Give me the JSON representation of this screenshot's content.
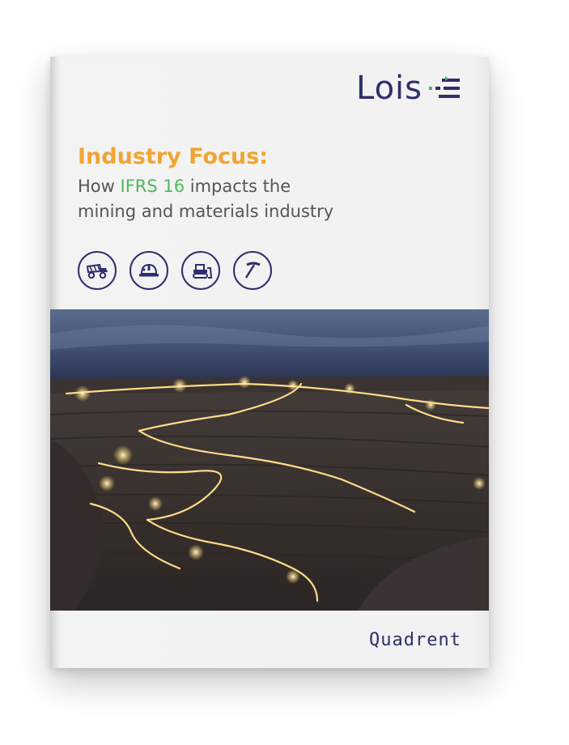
{
  "cover": {
    "logo_text": "Lois",
    "title": "Industry Focus:",
    "subtitle_pre": "How ",
    "subtitle_accent": "IFRS 16",
    "subtitle_post": " impacts the",
    "subtitle_line2": "mining and materials industry",
    "icons": [
      "mining-truck-icon",
      "hard-hat-icon",
      "bulldozer-icon",
      "pickaxe-icon"
    ],
    "footer_brand": "Quadrent"
  },
  "colors": {
    "title": "#f0a533",
    "accent": "#4fb75d",
    "brand": "#2e2e6e",
    "body_text": "#555555"
  }
}
